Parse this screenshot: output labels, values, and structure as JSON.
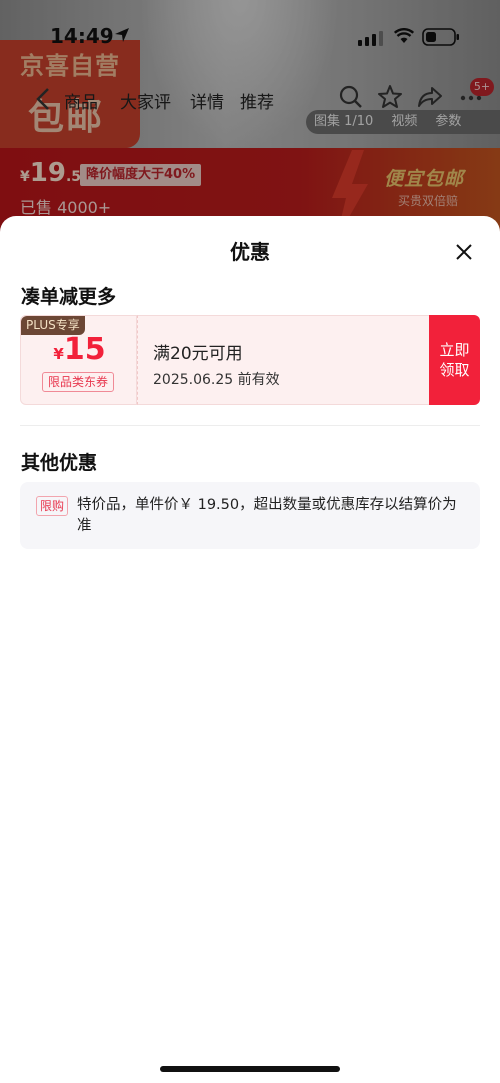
{
  "status_bar": {
    "time": "14:49"
  },
  "background": {
    "brand_line1": "京喜自营",
    "brand_line2": "包邮",
    "nav_tabs": [
      "商品",
      "大家评",
      "详情",
      "推荐"
    ],
    "more_badge": "5+",
    "image_counter": [
      "图集 1/10",
      "视频",
      "参数"
    ],
    "price": {
      "currency": "¥",
      "integer": "19",
      "decimal": ".5"
    },
    "price_drop_tag": "降价幅度大于40%",
    "sold": "已售 4000+",
    "promo_title": "便宜包邮",
    "promo_sub": "买贵双倍赔"
  },
  "sheet": {
    "title": "优惠",
    "section1_title": "凑单减更多",
    "coupon": {
      "plus_tag": "PLUS专享",
      "currency": "¥",
      "amount": "15",
      "scope": "限品类东券",
      "condition": "满20元可用",
      "expiry": "2025.06.25 前有效",
      "claim_line1": "立即",
      "claim_line2": "领取"
    },
    "section2_title": "其他优惠",
    "other": {
      "tag": "限购",
      "text": "特价品，单件价￥ 19.50，超出数量或优惠库存以结算价为准"
    }
  },
  "colors": {
    "accent_red": "#f2213a",
    "plus_brown": "#6c4735"
  }
}
